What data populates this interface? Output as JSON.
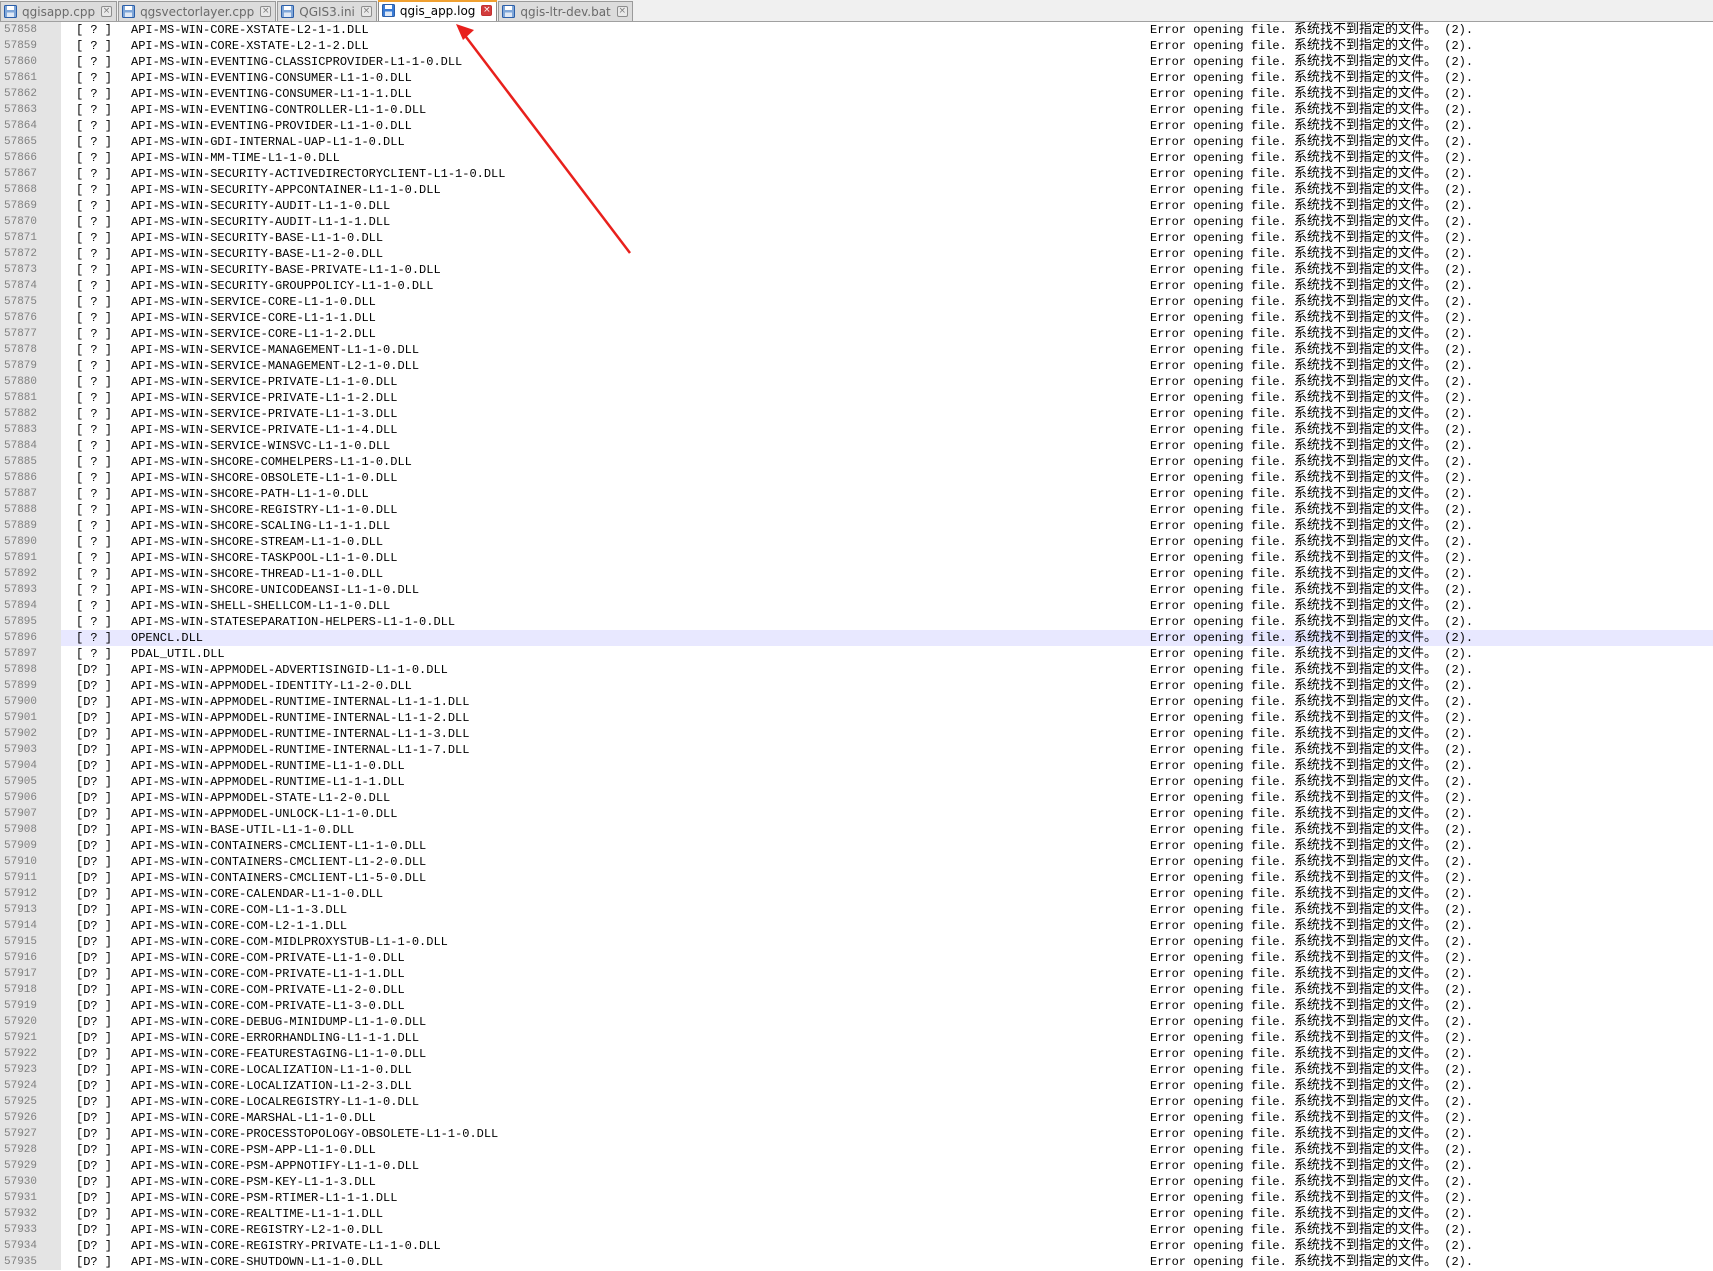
{
  "tabs": [
    {
      "label": "qgisapp.cpp",
      "active": false
    },
    {
      "label": "qgsvectorlayer.cpp",
      "active": false
    },
    {
      "label": "QGIS3.ini",
      "active": false
    },
    {
      "label": "qgis_app.log",
      "active": true
    },
    {
      "label": "qgis-ltr-dev.bat",
      "active": false
    }
  ],
  "colors": {
    "tab_active_accent": "#f0a030",
    "close_active": "#d23c3c",
    "annotation_arrow": "#e8201c",
    "current_line": "#e8e8ff"
  },
  "log": {
    "error_text": "Error opening file.",
    "error_zh": "系统找不到指定的文件。",
    "error_code": "(2).",
    "current_line_number": "57896",
    "lines": [
      {
        "n": "57858",
        "tag": "[ ? ]",
        "dll": "API-MS-WIN-CORE-XSTATE-L2-1-1.DLL"
      },
      {
        "n": "57859",
        "tag": "[ ? ]",
        "dll": "API-MS-WIN-CORE-XSTATE-L2-1-2.DLL"
      },
      {
        "n": "57860",
        "tag": "[ ? ]",
        "dll": "API-MS-WIN-EVENTING-CLASSICPROVIDER-L1-1-0.DLL"
      },
      {
        "n": "57861",
        "tag": "[ ? ]",
        "dll": "API-MS-WIN-EVENTING-CONSUMER-L1-1-0.DLL"
      },
      {
        "n": "57862",
        "tag": "[ ? ]",
        "dll": "API-MS-WIN-EVENTING-CONSUMER-L1-1-1.DLL"
      },
      {
        "n": "57863",
        "tag": "[ ? ]",
        "dll": "API-MS-WIN-EVENTING-CONTROLLER-L1-1-0.DLL"
      },
      {
        "n": "57864",
        "tag": "[ ? ]",
        "dll": "API-MS-WIN-EVENTING-PROVIDER-L1-1-0.DLL"
      },
      {
        "n": "57865",
        "tag": "[ ? ]",
        "dll": "API-MS-WIN-GDI-INTERNAL-UAP-L1-1-0.DLL"
      },
      {
        "n": "57866",
        "tag": "[ ? ]",
        "dll": "API-MS-WIN-MM-TIME-L1-1-0.DLL"
      },
      {
        "n": "57867",
        "tag": "[ ? ]",
        "dll": "API-MS-WIN-SECURITY-ACTIVEDIRECTORYCLIENT-L1-1-0.DLL"
      },
      {
        "n": "57868",
        "tag": "[ ? ]",
        "dll": "API-MS-WIN-SECURITY-APPCONTAINER-L1-1-0.DLL"
      },
      {
        "n": "57869",
        "tag": "[ ? ]",
        "dll": "API-MS-WIN-SECURITY-AUDIT-L1-1-0.DLL"
      },
      {
        "n": "57870",
        "tag": "[ ? ]",
        "dll": "API-MS-WIN-SECURITY-AUDIT-L1-1-1.DLL"
      },
      {
        "n": "57871",
        "tag": "[ ? ]",
        "dll": "API-MS-WIN-SECURITY-BASE-L1-1-0.DLL"
      },
      {
        "n": "57872",
        "tag": "[ ? ]",
        "dll": "API-MS-WIN-SECURITY-BASE-L1-2-0.DLL"
      },
      {
        "n": "57873",
        "tag": "[ ? ]",
        "dll": "API-MS-WIN-SECURITY-BASE-PRIVATE-L1-1-0.DLL"
      },
      {
        "n": "57874",
        "tag": "[ ? ]",
        "dll": "API-MS-WIN-SECURITY-GROUPPOLICY-L1-1-0.DLL"
      },
      {
        "n": "57875",
        "tag": "[ ? ]",
        "dll": "API-MS-WIN-SERVICE-CORE-L1-1-0.DLL"
      },
      {
        "n": "57876",
        "tag": "[ ? ]",
        "dll": "API-MS-WIN-SERVICE-CORE-L1-1-1.DLL"
      },
      {
        "n": "57877",
        "tag": "[ ? ]",
        "dll": "API-MS-WIN-SERVICE-CORE-L1-1-2.DLL"
      },
      {
        "n": "57878",
        "tag": "[ ? ]",
        "dll": "API-MS-WIN-SERVICE-MANAGEMENT-L1-1-0.DLL"
      },
      {
        "n": "57879",
        "tag": "[ ? ]",
        "dll": "API-MS-WIN-SERVICE-MANAGEMENT-L2-1-0.DLL"
      },
      {
        "n": "57880",
        "tag": "[ ? ]",
        "dll": "API-MS-WIN-SERVICE-PRIVATE-L1-1-0.DLL"
      },
      {
        "n": "57881",
        "tag": "[ ? ]",
        "dll": "API-MS-WIN-SERVICE-PRIVATE-L1-1-2.DLL"
      },
      {
        "n": "57882",
        "tag": "[ ? ]",
        "dll": "API-MS-WIN-SERVICE-PRIVATE-L1-1-3.DLL"
      },
      {
        "n": "57883",
        "tag": "[ ? ]",
        "dll": "API-MS-WIN-SERVICE-PRIVATE-L1-1-4.DLL"
      },
      {
        "n": "57884",
        "tag": "[ ? ]",
        "dll": "API-MS-WIN-SERVICE-WINSVC-L1-1-0.DLL"
      },
      {
        "n": "57885",
        "tag": "[ ? ]",
        "dll": "API-MS-WIN-SHCORE-COMHELPERS-L1-1-0.DLL"
      },
      {
        "n": "57886",
        "tag": "[ ? ]",
        "dll": "API-MS-WIN-SHCORE-OBSOLETE-L1-1-0.DLL"
      },
      {
        "n": "57887",
        "tag": "[ ? ]",
        "dll": "API-MS-WIN-SHCORE-PATH-L1-1-0.DLL"
      },
      {
        "n": "57888",
        "tag": "[ ? ]",
        "dll": "API-MS-WIN-SHCORE-REGISTRY-L1-1-0.DLL"
      },
      {
        "n": "57889",
        "tag": "[ ? ]",
        "dll": "API-MS-WIN-SHCORE-SCALING-L1-1-1.DLL"
      },
      {
        "n": "57890",
        "tag": "[ ? ]",
        "dll": "API-MS-WIN-SHCORE-STREAM-L1-1-0.DLL"
      },
      {
        "n": "57891",
        "tag": "[ ? ]",
        "dll": "API-MS-WIN-SHCORE-TASKPOOL-L1-1-0.DLL"
      },
      {
        "n": "57892",
        "tag": "[ ? ]",
        "dll": "API-MS-WIN-SHCORE-THREAD-L1-1-0.DLL"
      },
      {
        "n": "57893",
        "tag": "[ ? ]",
        "dll": "API-MS-WIN-SHCORE-UNICODEANSI-L1-1-0.DLL"
      },
      {
        "n": "57894",
        "tag": "[ ? ]",
        "dll": "API-MS-WIN-SHELL-SHELLCOM-L1-1-0.DLL"
      },
      {
        "n": "57895",
        "tag": "[ ? ]",
        "dll": "API-MS-WIN-STATESEPARATION-HELPERS-L1-1-0.DLL"
      },
      {
        "n": "57896",
        "tag": "[ ? ]",
        "dll": "OPENCL.DLL"
      },
      {
        "n": "57897",
        "tag": "[ ? ]",
        "dll": "PDAL_UTIL.DLL"
      },
      {
        "n": "57898",
        "tag": "[D? ]",
        "dll": "API-MS-WIN-APPMODEL-ADVERTISINGID-L1-1-0.DLL"
      },
      {
        "n": "57899",
        "tag": "[D? ]",
        "dll": "API-MS-WIN-APPMODEL-IDENTITY-L1-2-0.DLL"
      },
      {
        "n": "57900",
        "tag": "[D? ]",
        "dll": "API-MS-WIN-APPMODEL-RUNTIME-INTERNAL-L1-1-1.DLL"
      },
      {
        "n": "57901",
        "tag": "[D? ]",
        "dll": "API-MS-WIN-APPMODEL-RUNTIME-INTERNAL-L1-1-2.DLL"
      },
      {
        "n": "57902",
        "tag": "[D? ]",
        "dll": "API-MS-WIN-APPMODEL-RUNTIME-INTERNAL-L1-1-3.DLL"
      },
      {
        "n": "57903",
        "tag": "[D? ]",
        "dll": "API-MS-WIN-APPMODEL-RUNTIME-INTERNAL-L1-1-7.DLL"
      },
      {
        "n": "57904",
        "tag": "[D? ]",
        "dll": "API-MS-WIN-APPMODEL-RUNTIME-L1-1-0.DLL"
      },
      {
        "n": "57905",
        "tag": "[D? ]",
        "dll": "API-MS-WIN-APPMODEL-RUNTIME-L1-1-1.DLL"
      },
      {
        "n": "57906",
        "tag": "[D? ]",
        "dll": "API-MS-WIN-APPMODEL-STATE-L1-2-0.DLL"
      },
      {
        "n": "57907",
        "tag": "[D? ]",
        "dll": "API-MS-WIN-APPMODEL-UNLOCK-L1-1-0.DLL"
      },
      {
        "n": "57908",
        "tag": "[D? ]",
        "dll": "API-MS-WIN-BASE-UTIL-L1-1-0.DLL"
      },
      {
        "n": "57909",
        "tag": "[D? ]",
        "dll": "API-MS-WIN-CONTAINERS-CMCLIENT-L1-1-0.DLL"
      },
      {
        "n": "57910",
        "tag": "[D? ]",
        "dll": "API-MS-WIN-CONTAINERS-CMCLIENT-L1-2-0.DLL"
      },
      {
        "n": "57911",
        "tag": "[D? ]",
        "dll": "API-MS-WIN-CONTAINERS-CMCLIENT-L1-5-0.DLL"
      },
      {
        "n": "57912",
        "tag": "[D? ]",
        "dll": "API-MS-WIN-CORE-CALENDAR-L1-1-0.DLL"
      },
      {
        "n": "57913",
        "tag": "[D? ]",
        "dll": "API-MS-WIN-CORE-COM-L1-1-3.DLL"
      },
      {
        "n": "57914",
        "tag": "[D? ]",
        "dll": "API-MS-WIN-CORE-COM-L2-1-1.DLL"
      },
      {
        "n": "57915",
        "tag": "[D? ]",
        "dll": "API-MS-WIN-CORE-COM-MIDLPROXYSTUB-L1-1-0.DLL"
      },
      {
        "n": "57916",
        "tag": "[D? ]",
        "dll": "API-MS-WIN-CORE-COM-PRIVATE-L1-1-0.DLL"
      },
      {
        "n": "57917",
        "tag": "[D? ]",
        "dll": "API-MS-WIN-CORE-COM-PRIVATE-L1-1-1.DLL"
      },
      {
        "n": "57918",
        "tag": "[D? ]",
        "dll": "API-MS-WIN-CORE-COM-PRIVATE-L1-2-0.DLL"
      },
      {
        "n": "57919",
        "tag": "[D? ]",
        "dll": "API-MS-WIN-CORE-COM-PRIVATE-L1-3-0.DLL"
      },
      {
        "n": "57920",
        "tag": "[D? ]",
        "dll": "API-MS-WIN-CORE-DEBUG-MINIDUMP-L1-1-0.DLL"
      },
      {
        "n": "57921",
        "tag": "[D? ]",
        "dll": "API-MS-WIN-CORE-ERRORHANDLING-L1-1-1.DLL"
      },
      {
        "n": "57922",
        "tag": "[D? ]",
        "dll": "API-MS-WIN-CORE-FEATURESTAGING-L1-1-0.DLL"
      },
      {
        "n": "57923",
        "tag": "[D? ]",
        "dll": "API-MS-WIN-CORE-LOCALIZATION-L1-1-0.DLL"
      },
      {
        "n": "57924",
        "tag": "[D? ]",
        "dll": "API-MS-WIN-CORE-LOCALIZATION-L1-2-3.DLL"
      },
      {
        "n": "57925",
        "tag": "[D? ]",
        "dll": "API-MS-WIN-CORE-LOCALREGISTRY-L1-1-0.DLL"
      },
      {
        "n": "57926",
        "tag": "[D? ]",
        "dll": "API-MS-WIN-CORE-MARSHAL-L1-1-0.DLL"
      },
      {
        "n": "57927",
        "tag": "[D? ]",
        "dll": "API-MS-WIN-CORE-PROCESSTOPOLOGY-OBSOLETE-L1-1-0.DLL"
      },
      {
        "n": "57928",
        "tag": "[D? ]",
        "dll": "API-MS-WIN-CORE-PSM-APP-L1-1-0.DLL"
      },
      {
        "n": "57929",
        "tag": "[D? ]",
        "dll": "API-MS-WIN-CORE-PSM-APPNOTIFY-L1-1-0.DLL"
      },
      {
        "n": "57930",
        "tag": "[D? ]",
        "dll": "API-MS-WIN-CORE-PSM-KEY-L1-1-3.DLL"
      },
      {
        "n": "57931",
        "tag": "[D? ]",
        "dll": "API-MS-WIN-CORE-PSM-RTIMER-L1-1-1.DLL"
      },
      {
        "n": "57932",
        "tag": "[D? ]",
        "dll": "API-MS-WIN-CORE-REALTIME-L1-1-1.DLL"
      },
      {
        "n": "57933",
        "tag": "[D? ]",
        "dll": "API-MS-WIN-CORE-REGISTRY-L2-1-0.DLL"
      },
      {
        "n": "57934",
        "tag": "[D? ]",
        "dll": "API-MS-WIN-CORE-REGISTRY-PRIVATE-L1-1-0.DLL"
      },
      {
        "n": "57935",
        "tag": "[D? ]",
        "dll": "API-MS-WIN-CORE-SHUTDOWN-L1-1-0.DLL"
      }
    ]
  }
}
